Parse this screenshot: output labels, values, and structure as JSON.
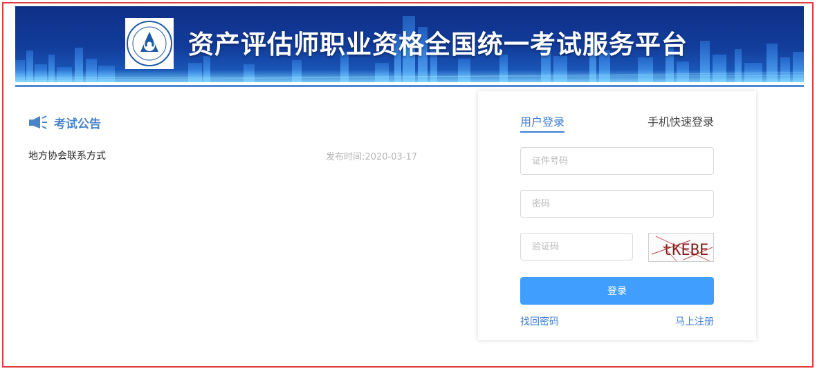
{
  "banner": {
    "title": "资产评估师职业资格全国统一考试服务平台",
    "logo_icon": "china-appraisal-society-logo",
    "colors": {
      "top": "#0e2f86",
      "bottom": "#1e63c4",
      "rule": "#4d88d6"
    }
  },
  "notice": {
    "icon": "megaphone-icon",
    "title": "考试公告",
    "items": [
      {
        "title": "地方协会联系方式",
        "date": "发布时间:2020-03-17"
      }
    ]
  },
  "login": {
    "tabs": [
      {
        "label": "用户登录",
        "active": true
      },
      {
        "label": "手机快速登录",
        "active": false
      }
    ],
    "id_field": {
      "placeholder": "证件号码",
      "value": ""
    },
    "password_field": {
      "placeholder": "密码",
      "value": ""
    },
    "captcha_field": {
      "placeholder": "验证码",
      "value": ""
    },
    "captcha_text": "tKEBE",
    "submit_label": "登录",
    "forgot_label": "找回密码",
    "register_label": "马上注册",
    "colors": {
      "accent": "#3d7ed2",
      "button": "#409eff",
      "captcha": "#8b1a1a"
    }
  },
  "page_border_color": "#e03b3b"
}
